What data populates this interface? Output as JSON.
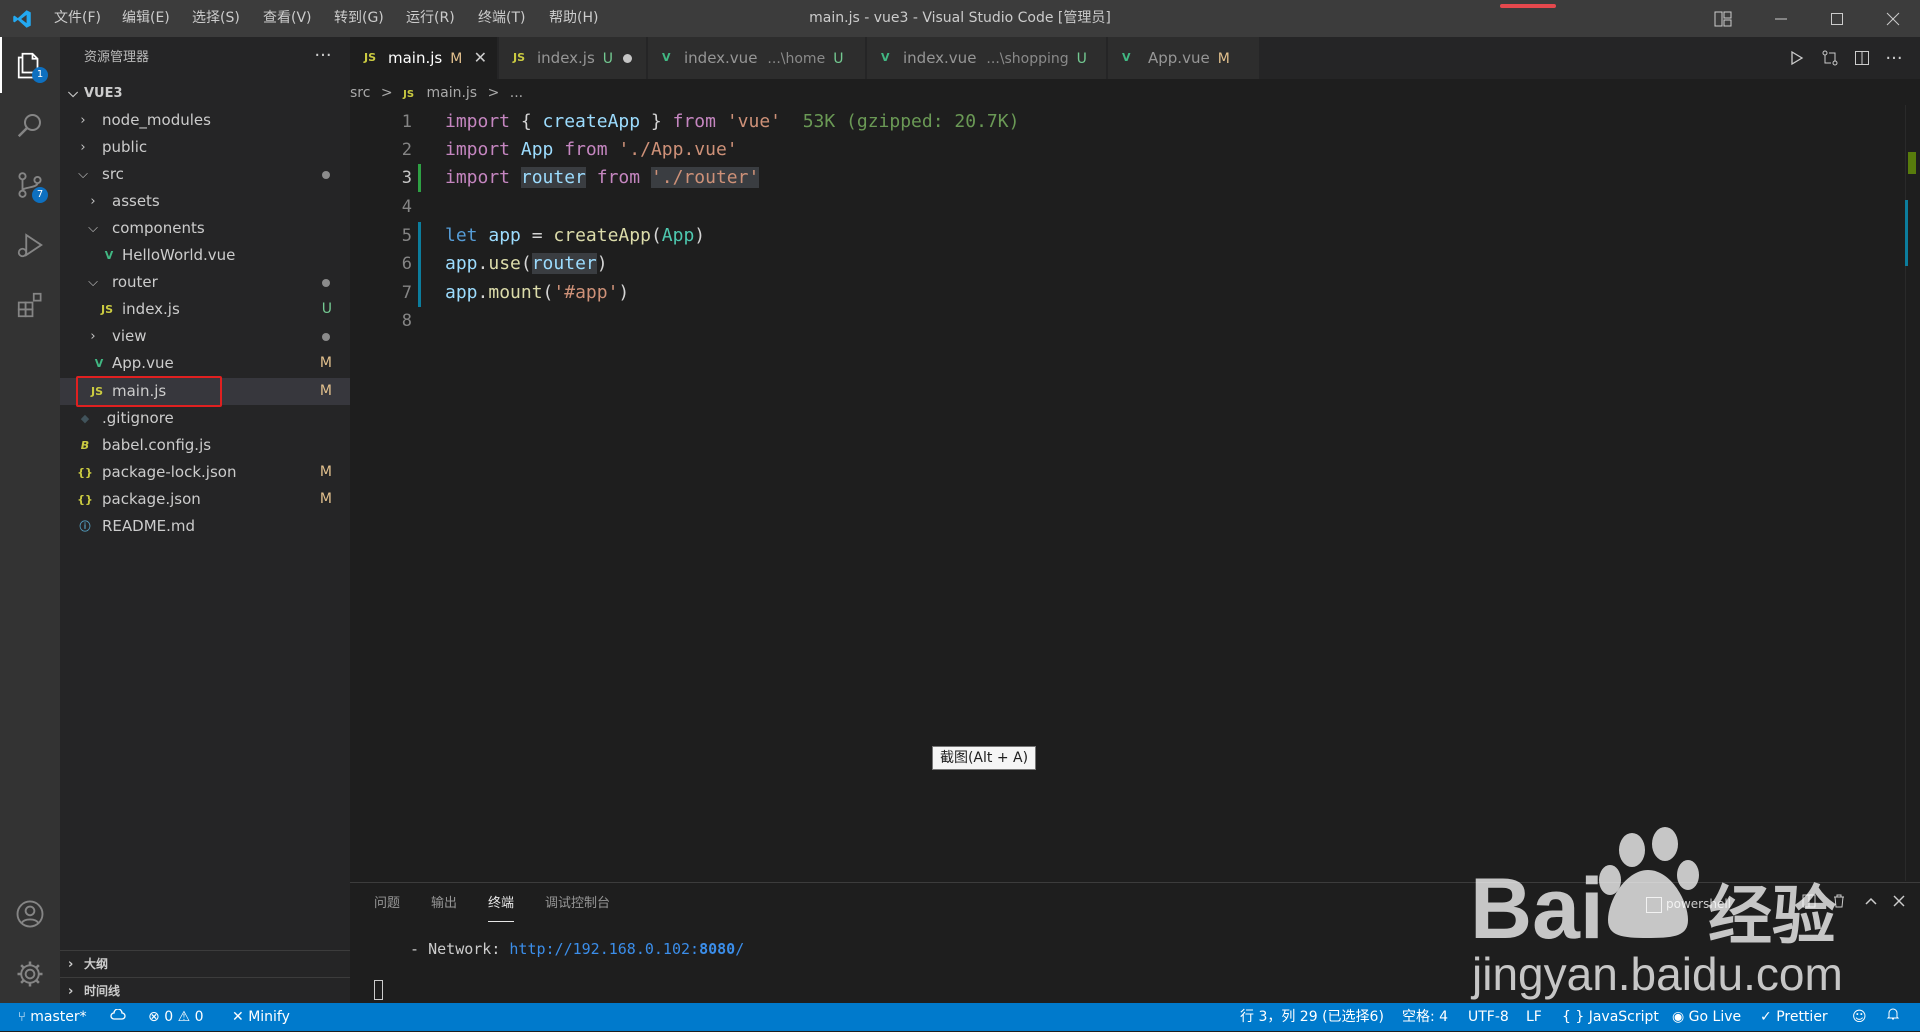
{
  "window": {
    "title": "main.js - vue3 - Visual Studio Code [管理员]",
    "menu": [
      "文件(F)",
      "编辑(E)",
      "选择(S)",
      "查看(V)",
      "转到(G)",
      "运行(R)",
      "终端(T)",
      "帮助(H)"
    ]
  },
  "activity_bar": {
    "explorer_badge": "1",
    "scm_badge": "7"
  },
  "sidebar": {
    "title": "资源管理器",
    "more": "···",
    "root": "VUE3",
    "items": [
      {
        "label": "node_modules",
        "status": ""
      },
      {
        "label": "public",
        "status": ""
      },
      {
        "label": "src",
        "status": ""
      },
      {
        "label": "assets",
        "status": ""
      },
      {
        "label": "components",
        "status": ""
      },
      {
        "label": "HelloWorld.vue",
        "status": ""
      },
      {
        "label": "router",
        "status": ""
      },
      {
        "label": "index.js",
        "status": "U"
      },
      {
        "label": "view",
        "status": ""
      },
      {
        "label": "App.vue",
        "status": "M"
      },
      {
        "label": "main.js",
        "status": "M"
      },
      {
        "label": ".gitignore",
        "status": ""
      },
      {
        "label": "babel.config.js",
        "status": ""
      },
      {
        "label": "package-lock.json",
        "status": "M"
      },
      {
        "label": "package.json",
        "status": "M"
      },
      {
        "label": "README.md",
        "status": ""
      }
    ],
    "outline": "大纲",
    "timeline": "时间线"
  },
  "tabs": [
    {
      "icon": "JS",
      "label": "main.js",
      "desc": "",
      "status": "M",
      "close": "✕"
    },
    {
      "icon": "JS",
      "label": "index.js",
      "desc": "",
      "status": "U"
    },
    {
      "icon": "V",
      "label": "index.vue",
      "desc": "...\\home",
      "status": "U"
    },
    {
      "icon": "V",
      "label": "index.vue",
      "desc": "...\\shopping",
      "status": "U"
    },
    {
      "icon": "V",
      "label": "App.vue",
      "desc": "",
      "status": "M"
    }
  ],
  "breadcrumb": {
    "folder": "src",
    "sep": ">",
    "icon": "JS",
    "file": "main.js",
    "tail": "..."
  },
  "editor": {
    "line_numbers": [
      "1",
      "2",
      "3",
      "4",
      "5",
      "6",
      "7",
      "8"
    ],
    "tokens": {
      "import": "import",
      "from": "from",
      "let": "let",
      "createApp": "createApp",
      "App": "App",
      "router": "router",
      "app": "app",
      "use": "use",
      "mount": "mount",
      "vue": "'vue'",
      "app_path": "'./App.vue'",
      "router_path": "'./router'",
      "app_sel": "'#app'",
      "size_hint": "53K (gzipped: 20.7K)"
    },
    "tooltip": "截图(Alt + A)"
  },
  "panel": {
    "tabs": [
      "问题",
      "输出",
      "终端",
      "调试控制台"
    ],
    "terminal_shell": "powershell",
    "terminal_prefix": "  - Network: ",
    "terminal_url": "http://192.168.0.102:",
    "terminal_port": "8080",
    "terminal_suffix": "/"
  },
  "statusbar": {
    "branch": "master*",
    "errors": "0",
    "warnings": "0",
    "minify": "Minify",
    "position": "行 3，列 29 (已选择6)",
    "spaces": "空格: 4",
    "encoding": "UTF-8",
    "eol": "LF",
    "language": "JavaScript",
    "golive": "Go Live",
    "prettier": "Prettier"
  },
  "watermark": {
    "brand": "Bai",
    "brand2": "经验",
    "url": "jingyan.baidu.com"
  },
  "colors": {
    "accent": "#007acc",
    "js_icon": "#cbcb41",
    "vue_icon": "#41b883",
    "modified": "#e2c08d",
    "untracked": "#73c991"
  }
}
